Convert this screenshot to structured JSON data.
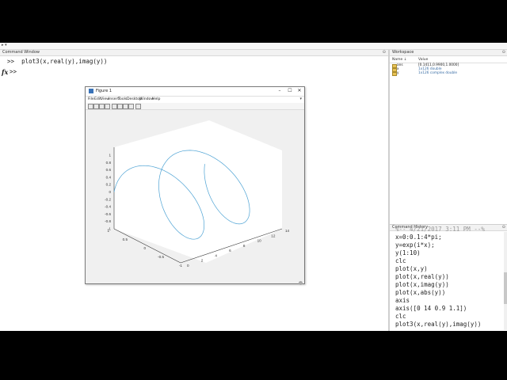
{
  "command_window": {
    "title": "Command Window",
    "lines": [
      "plot3(x,real(y),imag(y))"
    ],
    "prompt": ">>",
    "fx": "fx",
    "cursor_prompt": ">>"
  },
  "figure": {
    "title": "Figure 1",
    "menu": [
      "File",
      "Edit",
      "View",
      "Insert",
      "Tools",
      "Desktop",
      "Window",
      "Help"
    ],
    "z_ticks": [
      "1",
      "0.8",
      "0.6",
      "0.4",
      "0.2",
      "0",
      "-0.2",
      "-0.4",
      "-0.6",
      "-0.8",
      "-1"
    ],
    "y_ticks": [
      "1",
      "0.5",
      "0",
      "-0.5",
      "-1"
    ],
    "x_ticks": [
      "0",
      "2",
      "4",
      "6",
      "8",
      "10",
      "12",
      "14"
    ],
    "line_color": "#4ea3d4"
  },
  "workspace": {
    "title": "Workspace",
    "headers": {
      "name": "Name ↓",
      "value": "Value"
    },
    "rows": [
      {
        "name": "ans",
        "value": "[0.1411,0.9900,1.0000]"
      },
      {
        "name": "x",
        "value": "1x126 double"
      },
      {
        "name": "y",
        "value": "1x126 complex double"
      }
    ]
  },
  "history": {
    "title": "Command History",
    "lines": [
      "x=0:0.1:4*pi;",
      "y=exp(i*x);",
      "y(1:10)",
      "clc",
      "plot(x,y)",
      "plot(x,real(y))",
      "plot(x,imag(y))",
      "plot(x,abs(y))",
      "axis",
      "axis([0 14 0.9 1.1])",
      "clc",
      "plot3(x,real(y),imag(y))"
    ]
  }
}
